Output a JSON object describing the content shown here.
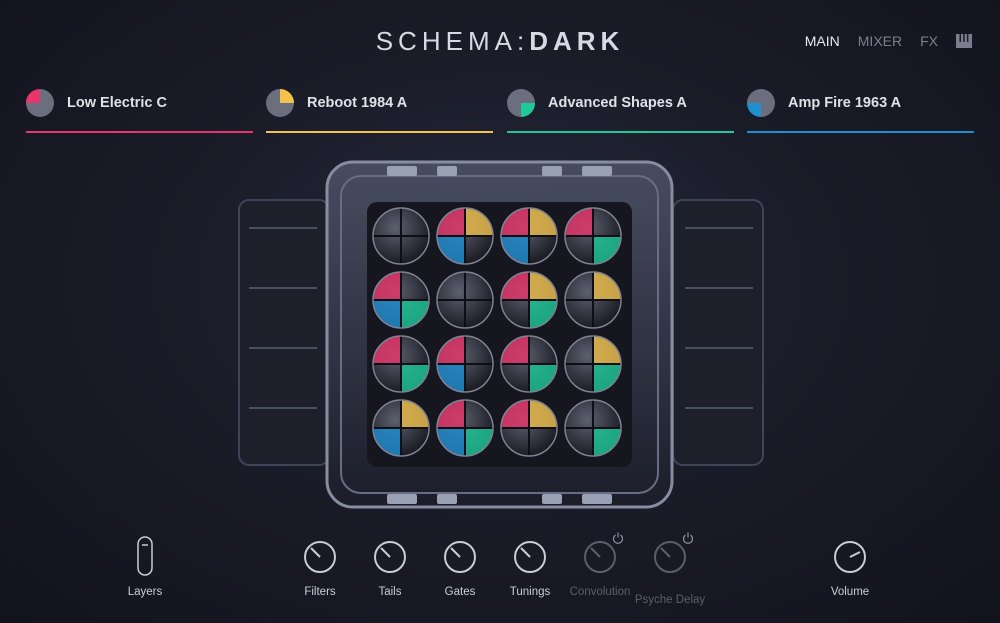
{
  "app": {
    "title_left": "SCHEMA",
    "title_sep": ":",
    "title_right": "DARK"
  },
  "nav": {
    "items": [
      {
        "label": "MAIN",
        "active": true
      },
      {
        "label": "MIXER",
        "active": false
      },
      {
        "label": "FX",
        "active": false
      }
    ],
    "keys_icon": "piano-keys-icon"
  },
  "presets": [
    {
      "name": "Low Electric C",
      "color": "#e8356a"
    },
    {
      "name": "Reboot 1984 A",
      "color": "#f3c24b"
    },
    {
      "name": "Advanced Shapes A",
      "color": "#1ec99a"
    },
    {
      "name": "Amp Fire 1963 A",
      "color": "#1f8fcf"
    }
  ],
  "controls": {
    "layers": "Layers",
    "filters": "Filters",
    "tails": "Tails",
    "gates": "Gates",
    "tunings": "Tunings",
    "convolution": "Convolution",
    "psyche_delay": "Psyche Delay",
    "volume": "Volume"
  },
  "colors": {
    "red": "#e8356a",
    "yellow": "#f3c24b",
    "green": "#1ec99a",
    "blue": "#1f8fcf"
  }
}
